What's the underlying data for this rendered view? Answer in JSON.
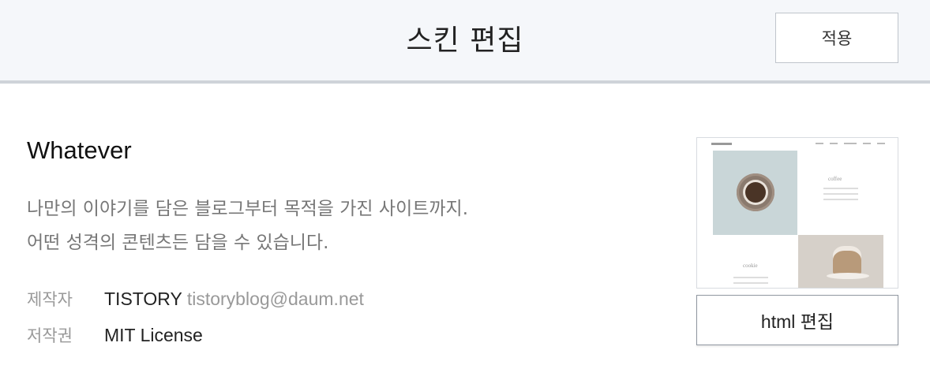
{
  "header": {
    "title": "스킨 편집",
    "apply_label": "적용"
  },
  "skin": {
    "name": "Whatever",
    "description_lines": [
      "나만의 이야기를 담은 블로그부터 목적을 가진 사이트까지.",
      "어떤 성격의 콘텐츠든 담을 수 있습니다."
    ],
    "author_label": "제작자",
    "author": "TISTORY",
    "author_email": "tistoryblog@daum.net",
    "license_label": "저작권",
    "license": "MIT License"
  },
  "preview": {
    "coffee_label": "coffee",
    "cookie_label": "cookie"
  },
  "html_edit_label": "html 편집"
}
